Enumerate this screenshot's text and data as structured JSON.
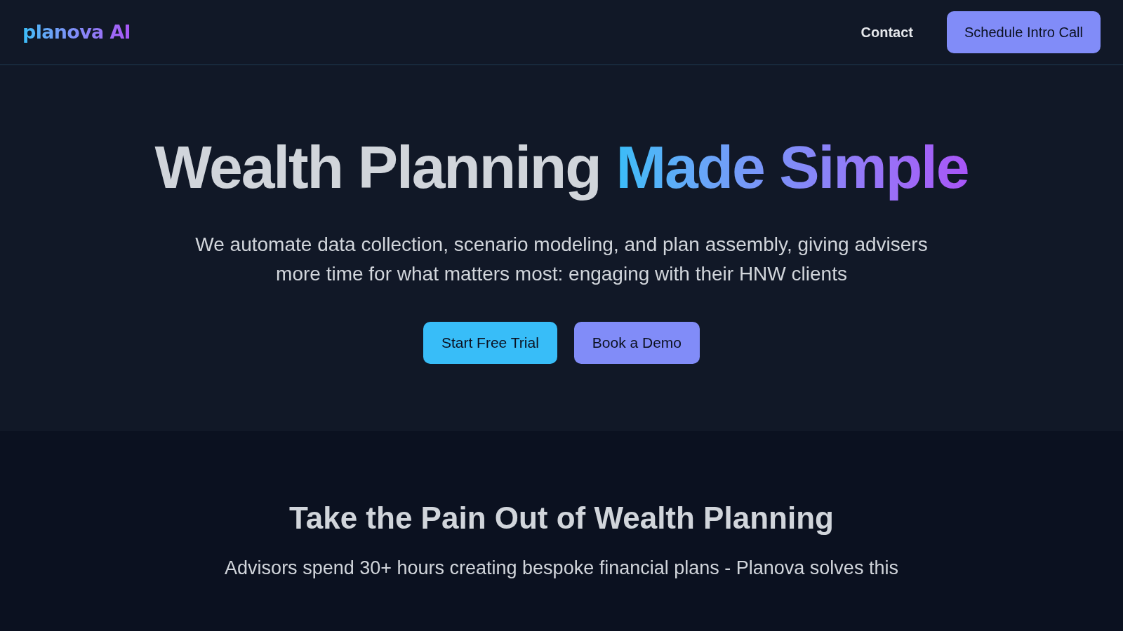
{
  "header": {
    "logo": "planova AI",
    "nav_link": "Contact",
    "cta_button": "Schedule Intro Call"
  },
  "hero": {
    "headline": "Wealth Planning",
    "headline_highlight": "Made Simple",
    "subtitle": "We automate data collection, scenario modeling, and plan assembly, giving advisers more time for what matters most: engaging with their HNW clients",
    "buttons": [
      {
        "label": "Start Free Trial",
        "kind": "primary"
      },
      {
        "label": "Book a Demo",
        "kind": "secondary"
      }
    ]
  },
  "pain_section": {
    "heading": "Take the Pain Out of Wealth Planning",
    "subtitle": "Advisors spend 30+ hours creating bespoke financial plans - Planova solves this"
  }
}
